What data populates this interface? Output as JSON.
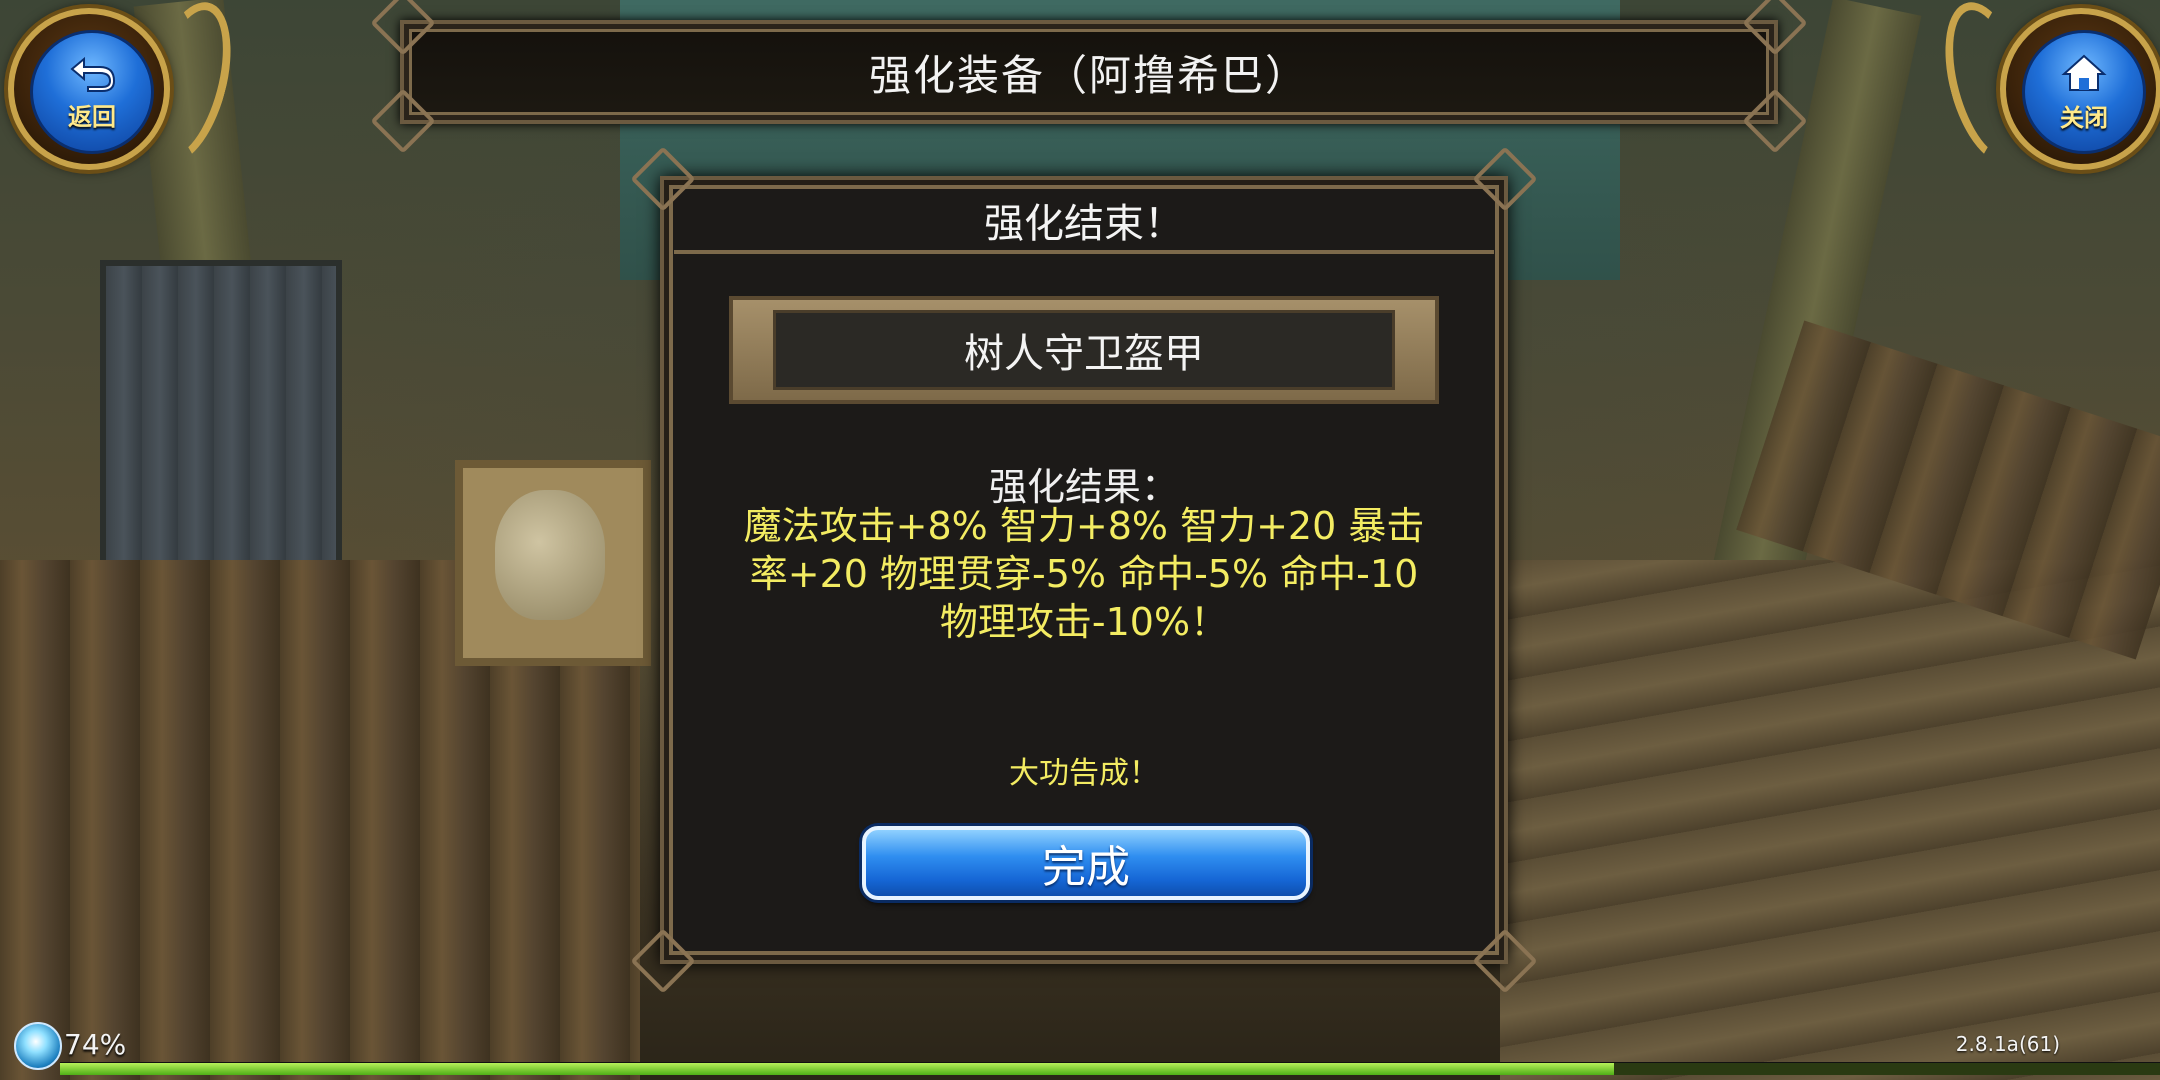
{
  "header": {
    "back_label": "返回",
    "close_label": "关闭",
    "title": "强化装备（阿撸希巴）"
  },
  "dialog": {
    "header_title": "强化结束！",
    "item_name": "树人守卫盔甲",
    "result_title": "强化结果：",
    "result_lines": [
      "魔法攻击+8% 智力+8% 智力+20 暴击",
      "率+20 物理贯穿-5% 命中-5% 命中-10",
      "物理攻击-10%！"
    ],
    "success_message": "大功告成！",
    "done_button_label": "完成"
  },
  "status": {
    "battery_text": "74%",
    "version": "2.8.1a(61)",
    "progress_fraction": 0.74
  },
  "colors": {
    "result_text": "#f3ec62",
    "button_blue": "#2f8ef0",
    "gold_frame": "#c8a34a"
  },
  "icons": {
    "back": "return-arrow-icon",
    "close": "home-icon",
    "status": "orb-icon"
  }
}
